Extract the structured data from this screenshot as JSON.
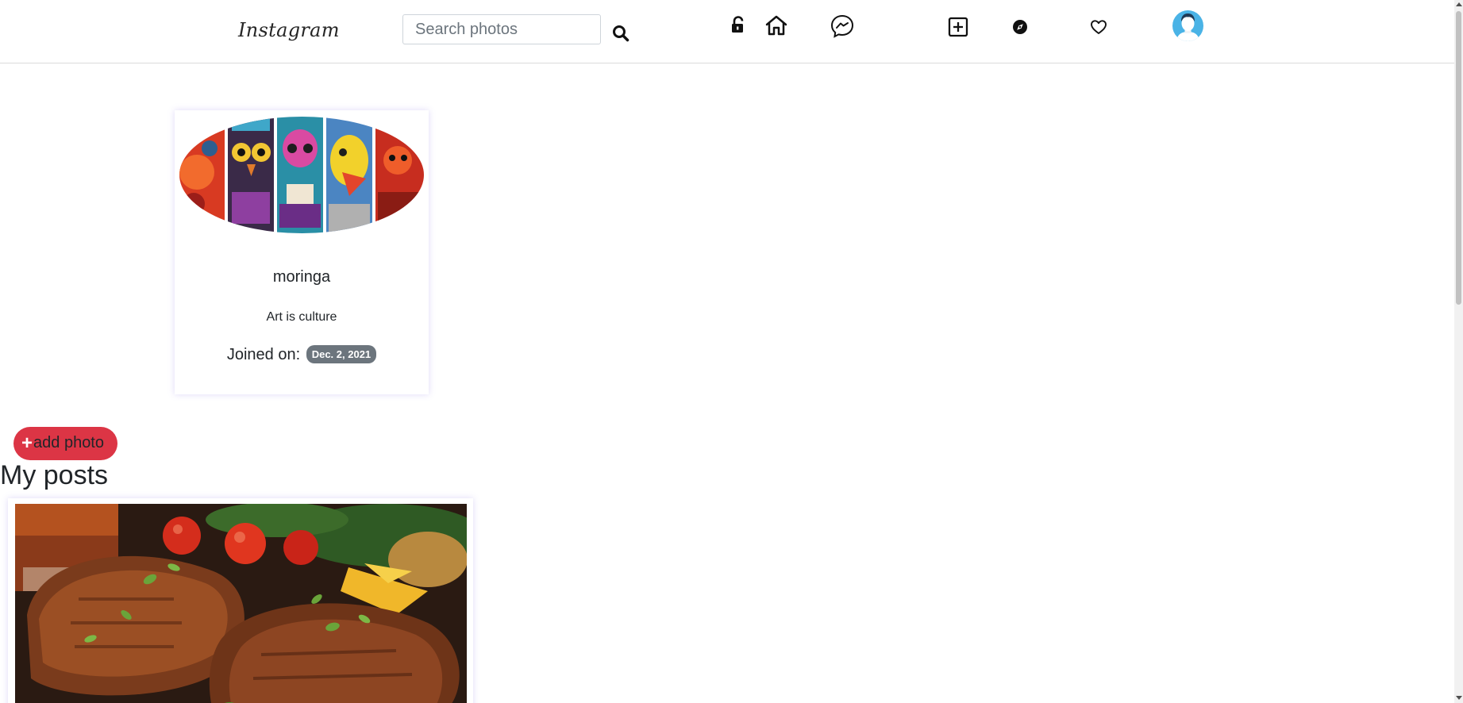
{
  "navbar": {
    "brand": "Instagram",
    "search_placeholder": "Search photos",
    "icons": [
      "search-icon",
      "logout-lock-icon",
      "home-icon",
      "messenger-icon",
      "new-post-icon",
      "explore-compass-icon",
      "activity-heart-icon",
      "profile-avatar-icon"
    ]
  },
  "profile": {
    "username": "moringa",
    "bio": "Art is culture",
    "joined_label": "Joined on:",
    "joined_date": "Dec. 2, 2021"
  },
  "actions": {
    "add_photo_label": "add photo",
    "add_photo_icon": "plus-icon"
  },
  "posts": {
    "title": "My posts"
  },
  "colors": {
    "accent_red": "#dc3545",
    "badge_gray": "#6c757d",
    "text": "#212529",
    "avatar_blue": "#4ab3e6"
  }
}
